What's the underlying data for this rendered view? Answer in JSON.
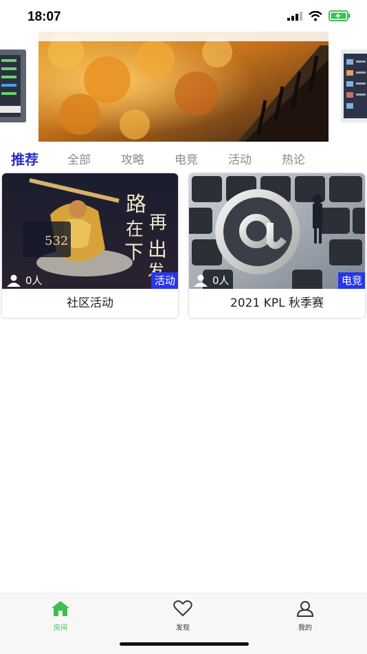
{
  "status_bar": {
    "time": "18:07",
    "battery_color": "#3fbe55"
  },
  "tabs": [
    {
      "label": "推荐",
      "active": true
    },
    {
      "label": "全部",
      "active": false
    },
    {
      "label": "攻略",
      "active": false
    },
    {
      "label": "电竞",
      "active": false
    },
    {
      "label": "活动",
      "active": false
    },
    {
      "label": "热论",
      "active": false
    }
  ],
  "cards": [
    {
      "title": "社区活动",
      "viewers": "0人",
      "tag": "活动"
    },
    {
      "title": "2021 KPL 秋季赛",
      "viewers": "0人",
      "tag": "电竞"
    }
  ],
  "bottom_nav": [
    {
      "label": "房间",
      "icon": "home-icon",
      "active": true
    },
    {
      "label": "发现",
      "icon": "heart-icon",
      "active": false
    },
    {
      "label": "我的",
      "icon": "user-icon",
      "active": false
    }
  ],
  "colors": {
    "accent": "#2a2ec9",
    "tag_bg": "#2636e8",
    "nav_active": "#3fbe55"
  }
}
